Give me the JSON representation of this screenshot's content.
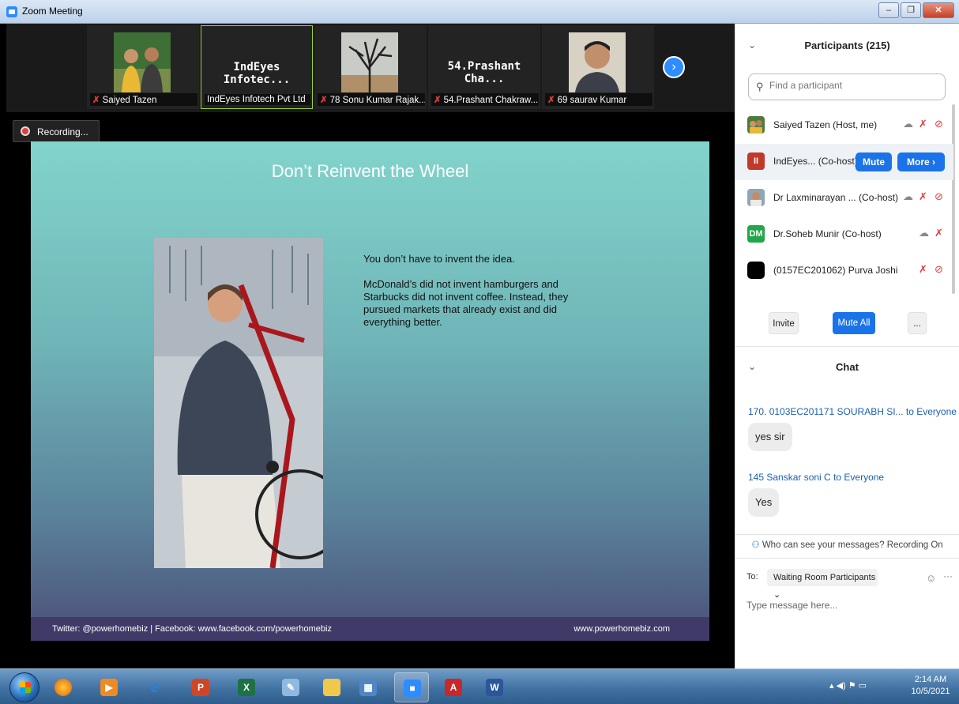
{
  "window": {
    "title": "Zoom Meeting",
    "min": "‒",
    "max": "❐",
    "close": "✕"
  },
  "strip": {
    "tiles": [
      {
        "label": "Saiyed Tazen",
        "big_name": ""
      },
      {
        "label": "IndEyes Infotech Pvt Ltd",
        "big_name": "IndEyes Infotec..."
      },
      {
        "label": "78 Sonu Kumar Rajak...",
        "big_name": ""
      },
      {
        "label": "54.Prashant Chakraw...",
        "big_name": "54.Prashant Cha..."
      },
      {
        "label": "69 saurav Kumar",
        "big_name": ""
      }
    ],
    "next_icon": "›"
  },
  "recording": {
    "label": "Recording..."
  },
  "slide": {
    "title": "Don’t Reinvent the Wheel",
    "para1": "You don’t have to invent the idea.",
    "para2": "McDonald’s did not invent hamburgers and Starbucks did not invent coffee. Instead, they pursued markets that already exist and did everything better.",
    "footer_left": "Twitter: @powerhomebiz  | Facebook: www.facebook.com/powerhomebiz",
    "footer_right": "www.powerhomebiz.com"
  },
  "participants": {
    "title": "Participants (215)",
    "collapse_icon": "⌄",
    "search_placeholder": "Find a participant",
    "search_icon": "⚲",
    "rows": [
      {
        "name": "Saiyed Tazen (Host, me)",
        "avatar": ""
      },
      {
        "name": "IndEyes... (Co-host)",
        "avatar": "II"
      },
      {
        "name": "Dr Laxminarayan ... (Co-host)",
        "avatar": ""
      },
      {
        "name": "Dr.Soheb Munir (Co-host)",
        "avatar": "DM"
      },
      {
        "name": "(0157EC201062) Purva Joshi",
        "avatar": ""
      }
    ],
    "mute_label": "Mute",
    "more_label": "More ›",
    "invite_label": "Invite",
    "mute_all_label": "Mute All",
    "more_dots_label": "..."
  },
  "chat": {
    "title": "Chat",
    "collapse_icon": "⌄",
    "messages": [
      {
        "sender": "170. 0103EC201171 SOURABH SI...",
        "to": " to Everyone",
        "text": "yes sir"
      },
      {
        "sender": "145 Sanskar soni C",
        "to": " to Everyone",
        "text": "Yes"
      }
    ],
    "who_can_see": "Who can see your messages? Recording On",
    "to_label": "To:",
    "to_value": "Waiting Room Participants ⌄",
    "emoji_icon": "☺",
    "more_icon": "···",
    "input_placeholder": "Type message here..."
  },
  "icons": {
    "mic_off": "✗",
    "video_off": "⊘",
    "cloud": "☁"
  },
  "taskbar": {
    "items": [
      "firefox",
      "media-player",
      "internet-explorer",
      "powerpoint-red",
      "excel",
      "paint",
      "file-explorer",
      "photo-viewer",
      "zoom",
      "acrobat",
      "word"
    ],
    "tray_icons": "▴  ◀)  ⚑  ▭",
    "time": "2:14 AM",
    "date": "10/5/2021"
  },
  "colors": {
    "accent_blue": "#1a73e8",
    "zoom_blue": "#2d8cff",
    "muted_red": "#e23c3c"
  }
}
